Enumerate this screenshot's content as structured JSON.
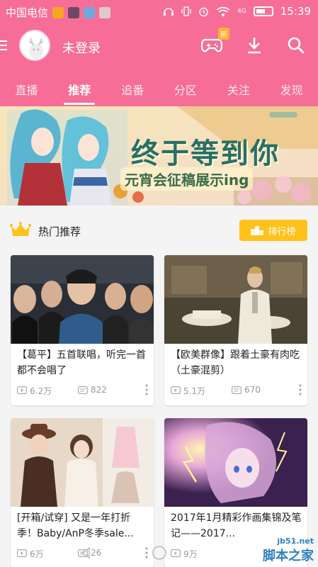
{
  "status_bar": {
    "carrier": "中国电信",
    "network": "4G",
    "time": "15:39"
  },
  "header": {
    "login_status": "未登录",
    "new_badge": "新"
  },
  "tabs": [
    {
      "label": "直播"
    },
    {
      "label": "推荐",
      "active": true
    },
    {
      "label": "追番"
    },
    {
      "label": "分区"
    },
    {
      "label": "关注"
    },
    {
      "label": "发现"
    }
  ],
  "banner": {
    "title": "终于等到你",
    "subtitle": "元宵会征稿展示ing"
  },
  "section": {
    "title": "热门推荐",
    "rank_button": "排行榜"
  },
  "cards": [
    {
      "title": "【葛平】五首联唱，听完一首都不会唱了",
      "views": "6.2万",
      "danmaku": "822"
    },
    {
      "title": "【欧美群像】跟着土豪有肉吃（土豪混剪）",
      "views": "5.1万",
      "danmaku": "670"
    },
    {
      "title": "[开箱/试穿] 又是一年打折季！Baby/AnP冬季sale...",
      "views": "6万",
      "danmaku": "26"
    },
    {
      "title": "2017年1月精彩作画集锦及笔记——2017...",
      "views": "9万",
      "danmaku": ""
    }
  ],
  "watermark": {
    "url": "jb51.net",
    "name": "脚本之家"
  },
  "colors": {
    "header_pink": "#f66e97",
    "rank_yellow": "#ffc21a",
    "badge_orange": "#ffb12b"
  },
  "icons": [
    "menu-icon",
    "game-icon",
    "download-icon",
    "search-icon",
    "crown-icon",
    "play-icon",
    "danmaku-icon",
    "more-icon",
    "battery-icon",
    "wifi-icon"
  ]
}
